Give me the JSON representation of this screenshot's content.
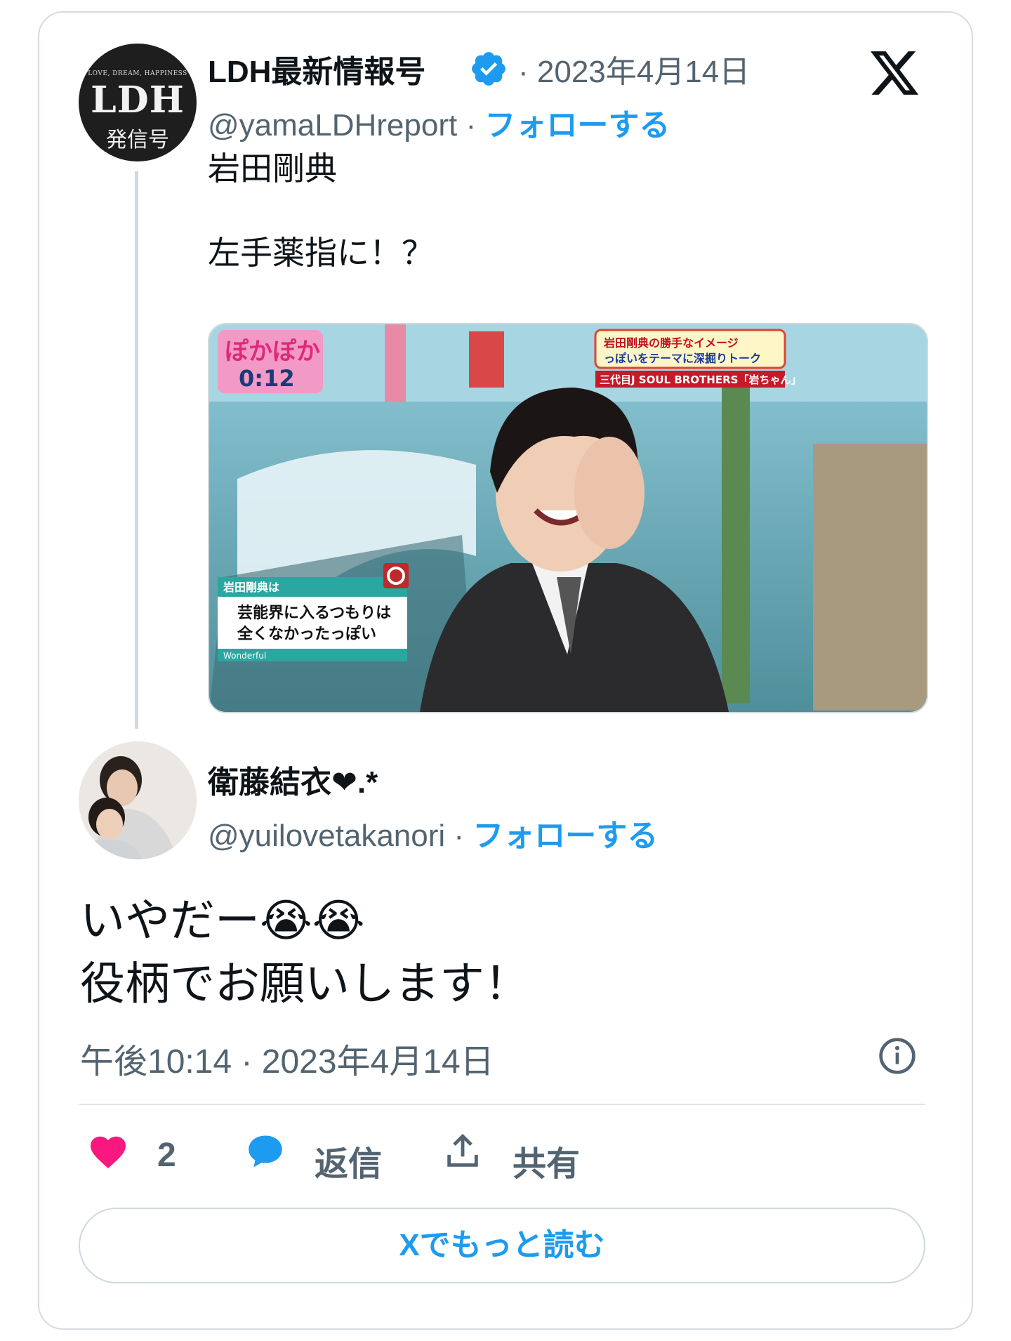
{
  "quoted_tweet": {
    "author_name": "LDH最新情報号",
    "handle": "@yamaLDHreport",
    "separator": "·",
    "date": "2023年4月14日",
    "follow_label": "フォローする",
    "text": "岩田剛典\n\n左手薬指に！？",
    "avatar": {
      "line1": "LOVE, DREAM, HAPPINESS",
      "line2": "LDH",
      "line3": "発信号"
    },
    "media": {
      "logo_text": "ぽかぽか",
      "timer": "0:12",
      "banner_line1": "岩田剛典の勝手なイメージ",
      "banner_line2": "っぽいをテーマに深掘りトーク",
      "banner_line3": "三代目J SOUL BROTHERS「岩ちゃん」",
      "caption_header": "岩田剛典は",
      "caption_line1": "芸能界に入るつもりは",
      "caption_line2": "全くなかったっぽい",
      "caption_footer": "Wonderful"
    }
  },
  "reply": {
    "author_name": "衛藤結衣❤.*",
    "handle": "@yuilovetakanori",
    "separator": "·",
    "follow_label": "フォローする",
    "text": "いやだー😭😭\n役柄でお願いします！",
    "timestamp": "午後10:14 · 2023年4月14日"
  },
  "actions": {
    "like_count": "2",
    "reply_label": "返信",
    "share_label": "共有"
  },
  "read_more_label": "Xでもっと読む",
  "colors": {
    "accent": "#1d9bf0",
    "like": "#f91880",
    "muted": "#536471"
  },
  "icons": [
    "verified-badge-icon",
    "x-logo-icon",
    "info-icon",
    "heart-icon",
    "reply-bubble-icon",
    "share-icon"
  ]
}
